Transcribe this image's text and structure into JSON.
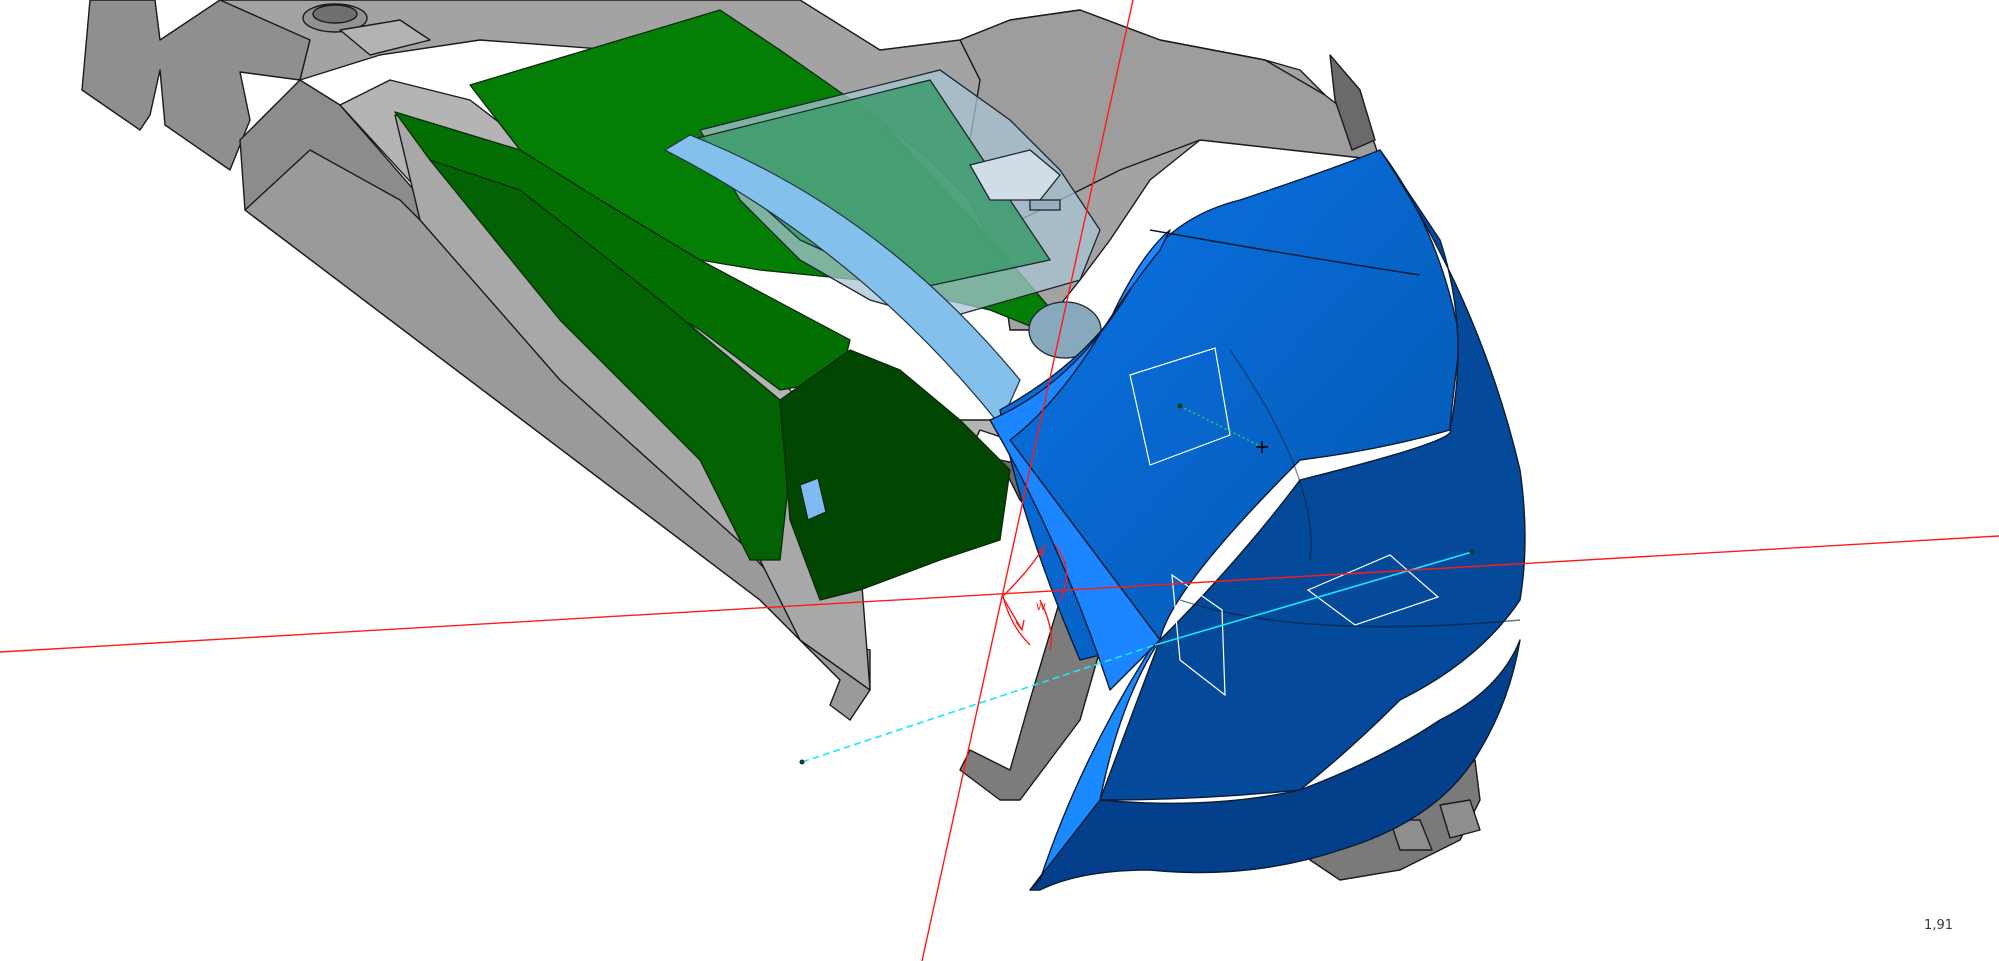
{
  "viewport": {
    "zoom_level": "1,91",
    "background_color": "#ffffff"
  },
  "model": {
    "body_colors": {
      "gray_top": "#9c9c9c",
      "gray_mid": "#8a8a8a",
      "gray_dark": "#5e5e5e",
      "gray_light": "#b8b8b8",
      "green_top": "#037a03",
      "green_mid": "#026502",
      "green_dark": "#014201",
      "blue_top": "#0a6fe0",
      "blue_mid": "#0a62c6",
      "blue_dark": "#034790",
      "blue_edge": "#1b86ff",
      "light_blue_strip": "#84c0ec",
      "transparent_tint": "#a7c6d8"
    }
  },
  "axes": {
    "axis_color": "#ff0000",
    "projection_line_color": "#19e6ff",
    "distance_line_color": "#16c043",
    "plane_outline_color": "#ffffff"
  }
}
